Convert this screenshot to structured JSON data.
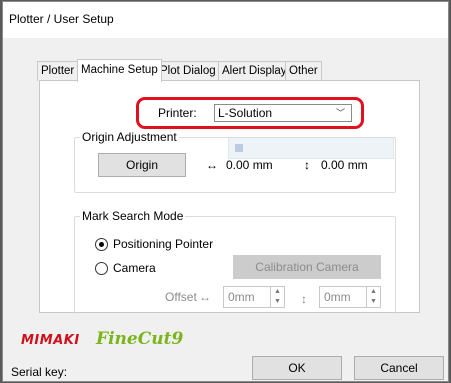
{
  "window": {
    "title": "Plotter / User Setup"
  },
  "tabs": [
    {
      "label": "Plotter",
      "active": false
    },
    {
      "label": "Machine Setup",
      "active": true
    },
    {
      "label": "Plot Dialog",
      "active": false
    },
    {
      "label": "Alert Display",
      "active": false
    },
    {
      "label": "Other",
      "active": false
    }
  ],
  "printer": {
    "label": "Printer:",
    "value": "L-Solution"
  },
  "origin_adjustment": {
    "title": "Origin Adjustment",
    "button": "Origin",
    "x_arrow": "↔",
    "x_value": "0.00 mm",
    "y_arrow": "↕",
    "y_value": "0.00 mm"
  },
  "mark_search": {
    "title": "Mark Search Mode",
    "option_pointer": "Positioning Pointer",
    "option_camera": "Camera",
    "selected": "Positioning Pointer",
    "calibration_button": "Calibration Camera",
    "offset_label": "Offset",
    "offset_x_arrow": "↔",
    "offset_x": "0mm",
    "offset_y_arrow": "↕",
    "offset_y": "0mm"
  },
  "branding": {
    "mimaki": "MIMAKI",
    "product": "FineCut9"
  },
  "footer": {
    "serial_label": "Serial key:",
    "ok": "OK",
    "cancel": "Cancel"
  },
  "colors": {
    "highlight": "#e0101e",
    "mimaki_red": "#d0101a",
    "finecut_green": "#7ab51d"
  }
}
